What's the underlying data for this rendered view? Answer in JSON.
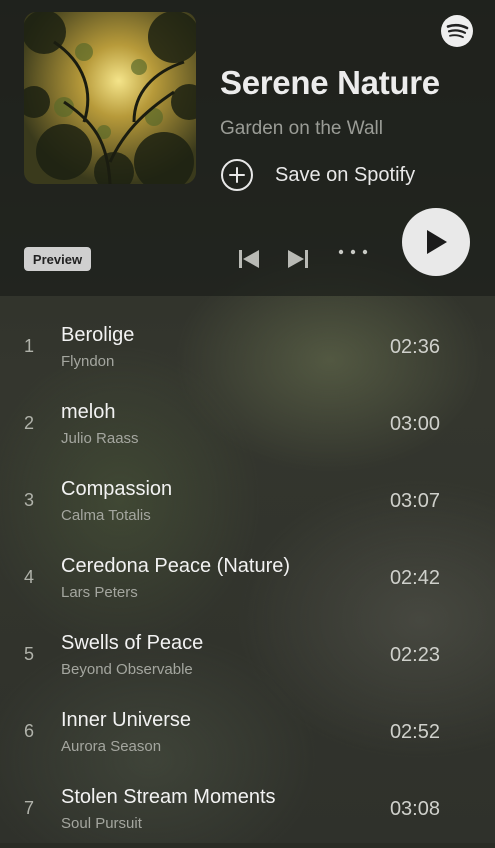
{
  "album": {
    "title": "Serene Nature",
    "artist": "Garden on the Wall",
    "save_label": "Save on Spotify",
    "preview_label": "Preview"
  },
  "icons": {
    "logo": "spotify-logo-icon",
    "save": "plus-circle-icon",
    "prev": "skip-previous-icon",
    "next": "skip-next-icon",
    "more": "more-horizontal-icon",
    "play": "play-icon"
  },
  "colors": {
    "play_button": "#e9e9e9",
    "badge": "#cfcfcf"
  },
  "tracks": [
    {
      "num": "1",
      "title": "Berolige",
      "artist": "Flyndon",
      "duration": "02:36"
    },
    {
      "num": "2",
      "title": "meloh",
      "artist": "Julio Raass",
      "duration": "03:00"
    },
    {
      "num": "3",
      "title": "Compassion",
      "artist": "Calma Totalis",
      "duration": "03:07"
    },
    {
      "num": "4",
      "title": "Ceredona Peace (Nature)",
      "artist": "Lars Peters",
      "duration": "02:42"
    },
    {
      "num": "5",
      "title": "Swells of Peace",
      "artist": "Beyond Observable",
      "duration": "02:23"
    },
    {
      "num": "6",
      "title": "Inner Universe",
      "artist": "Aurora Season",
      "duration": "02:52"
    },
    {
      "num": "7",
      "title": "Stolen Stream Moments",
      "artist": "Soul Pursuit",
      "duration": "03:08"
    }
  ]
}
